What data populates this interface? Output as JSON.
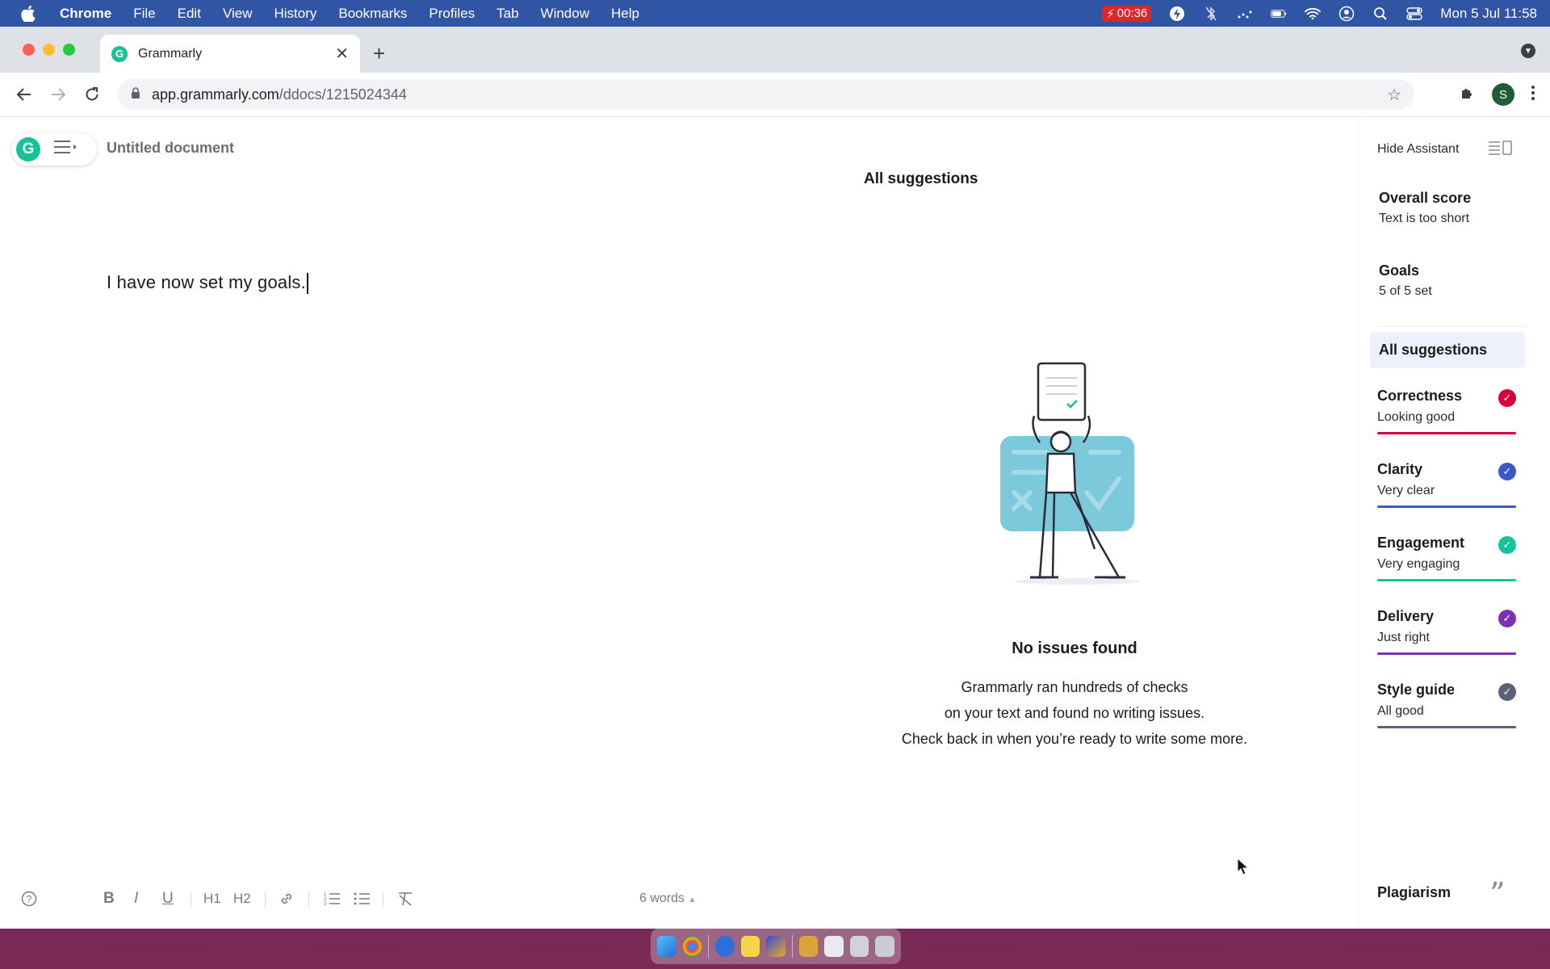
{
  "menubar": {
    "app": "Chrome",
    "items": [
      "File",
      "Edit",
      "View",
      "History",
      "Bookmarks",
      "Profiles",
      "Tab",
      "Window",
      "Help"
    ],
    "recording_time": "00:36",
    "datetime": "Mon 5 Jul  11:58"
  },
  "browser": {
    "tab_title": "Grammarly",
    "url_host": "app.grammarly.com",
    "url_path": "/ddocs/1215024344",
    "avatar_letter": "S"
  },
  "editor": {
    "doc_title": "Untitled document",
    "text": "I have now set my goals.",
    "word_count": "6 words",
    "format_buttons": [
      "B",
      "I",
      "U",
      "H1",
      "H2"
    ]
  },
  "suggestions": {
    "header": "All suggestions",
    "no_issues_title": "No issues found",
    "no_issues_lines": [
      "Grammarly ran hundreds of checks",
      "on your text and found no writing issues.",
      "Check back in when you’re ready to write some more."
    ]
  },
  "assistant": {
    "hide_label": "Hide Assistant",
    "overall_title": "Overall score",
    "overall_sub": "Text is too short",
    "goals_title": "Goals",
    "goals_sub": "5 of 5 set",
    "all_suggestions": "All suggestions",
    "categories": [
      {
        "title": "Correctness",
        "sub": "Looking good",
        "color": "#d4003c"
      },
      {
        "title": "Clarity",
        "sub": "Very clear",
        "color": "#3b57c7"
      },
      {
        "title": "Engagement",
        "sub": "Very engaging",
        "color": "#15c39a"
      },
      {
        "title": "Delivery",
        "sub": "Just right",
        "color": "#7a32b5"
      },
      {
        "title": "Style guide",
        "sub": "All good",
        "color": "#5b6177"
      }
    ],
    "plagiarism": "Plagiarism"
  }
}
